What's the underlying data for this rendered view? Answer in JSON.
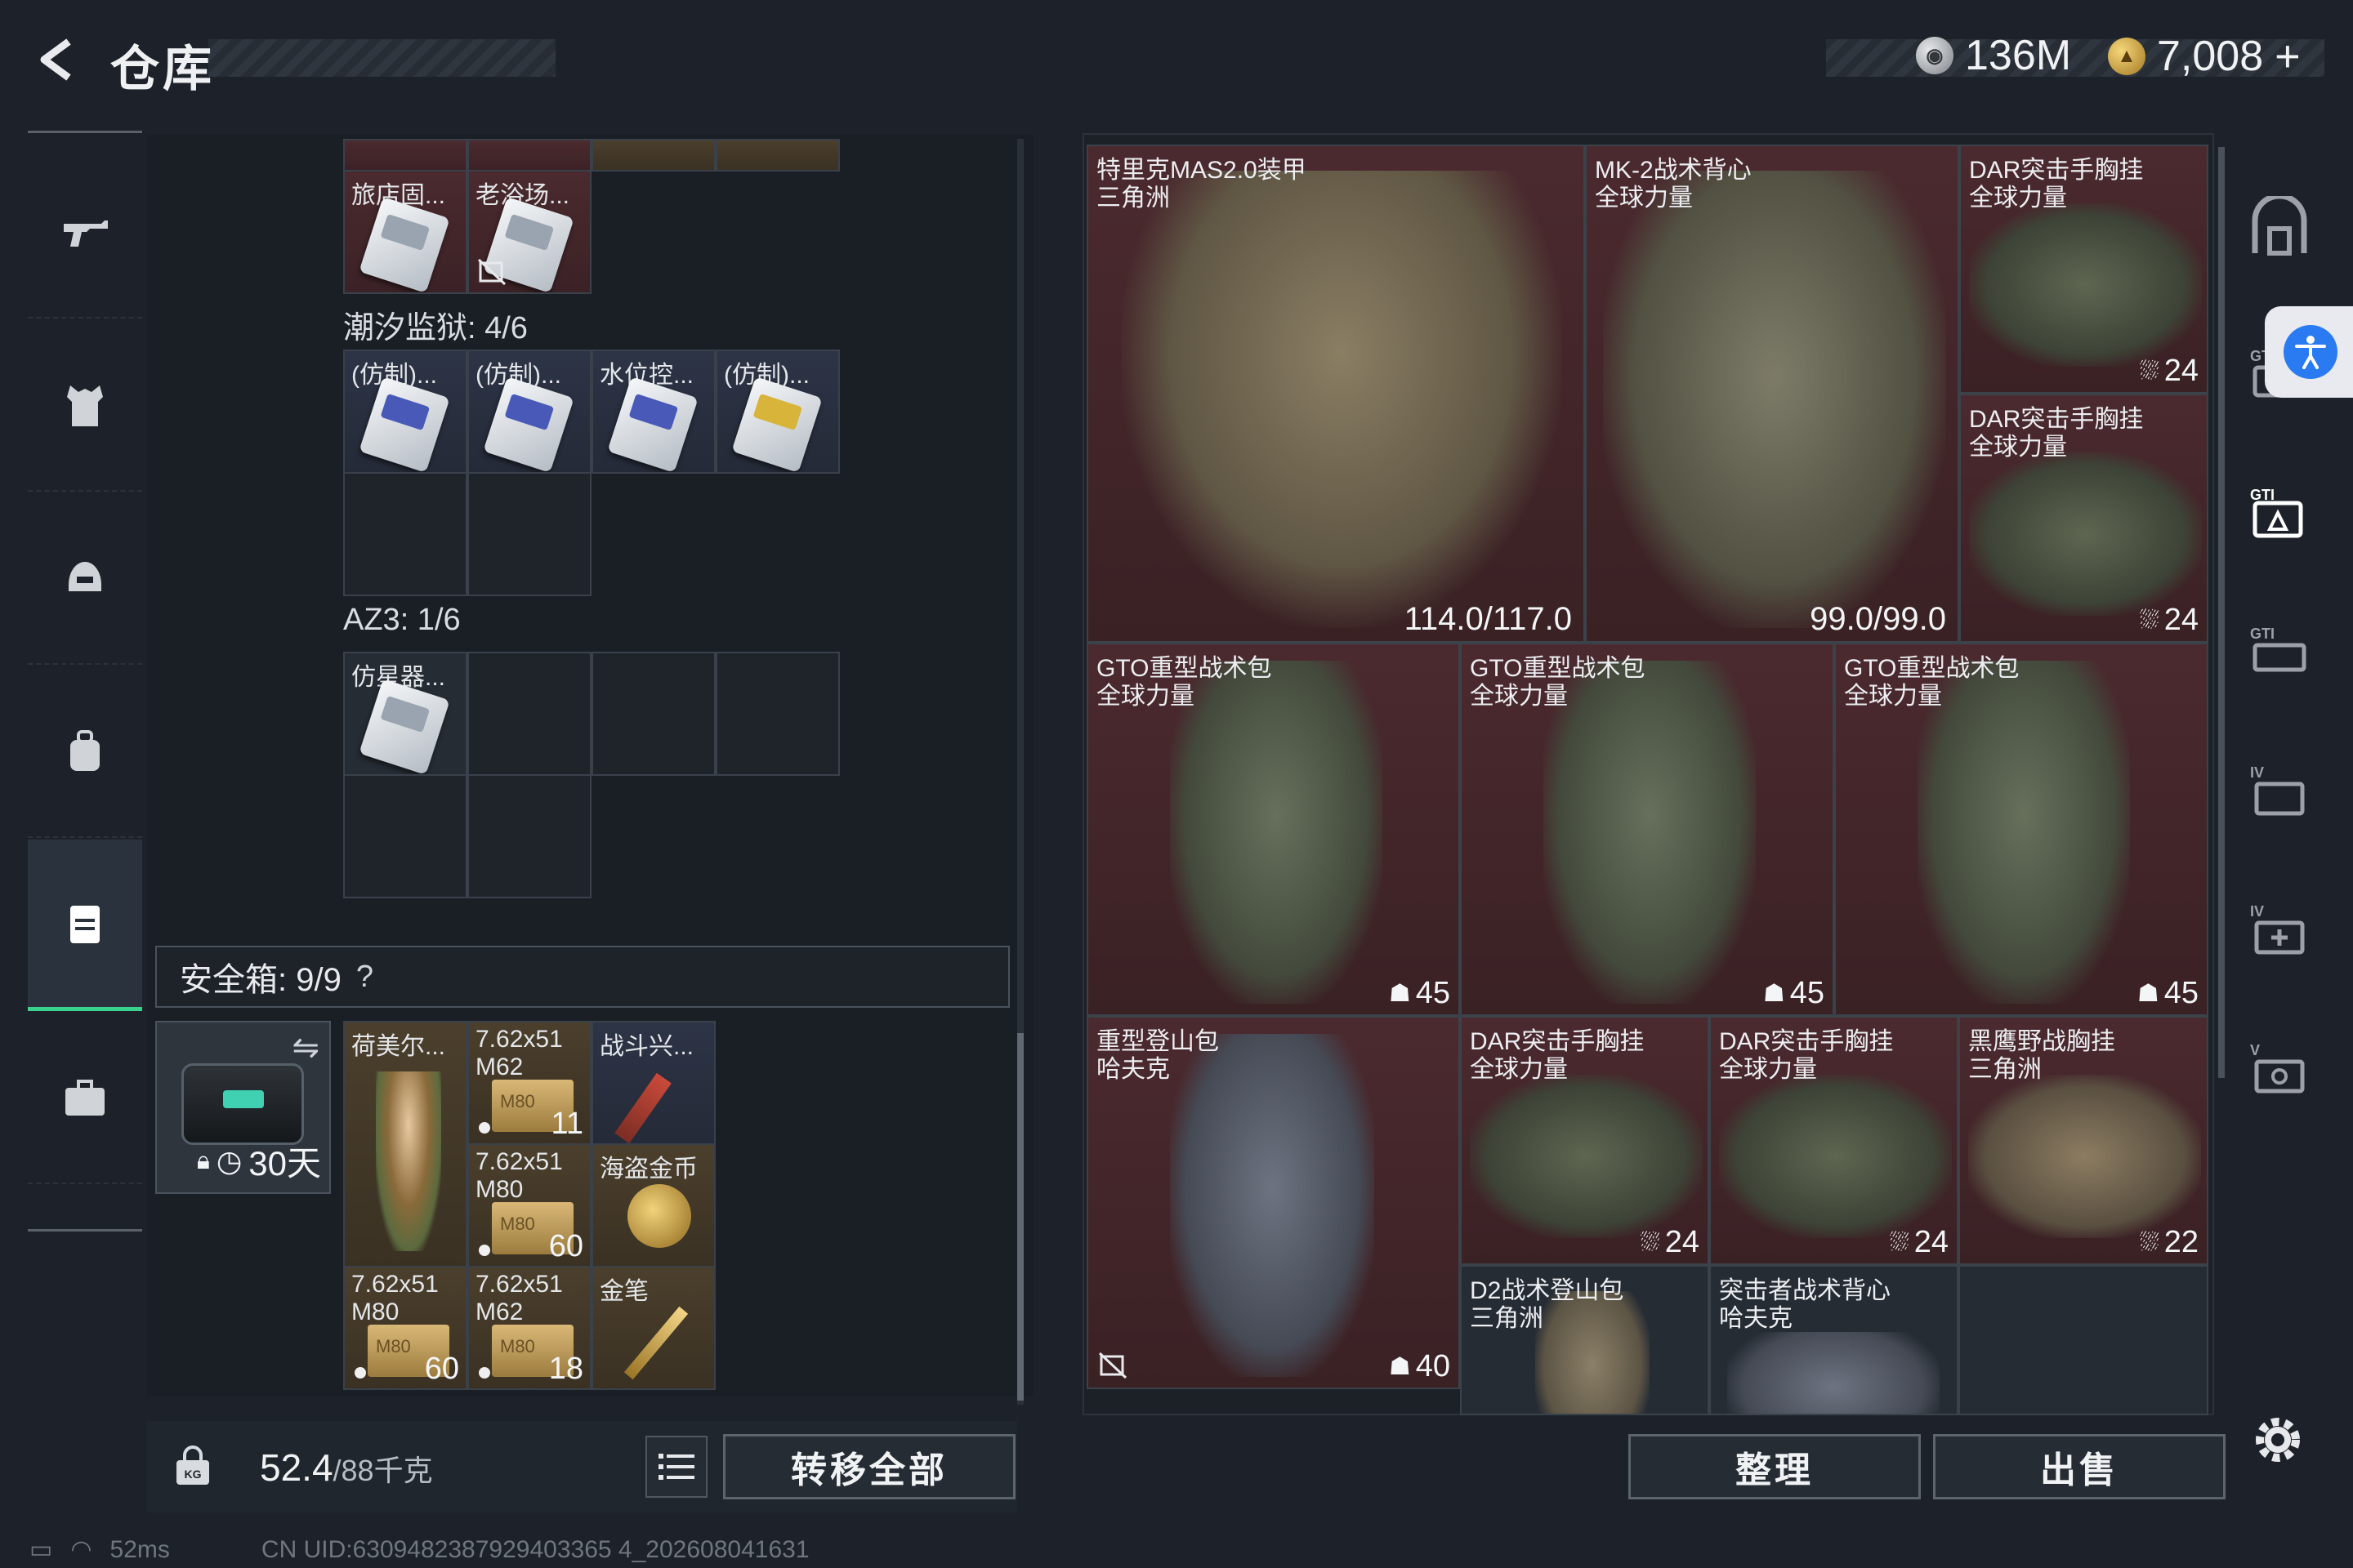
{
  "header": {
    "title": "仓库",
    "currencies": [
      {
        "icon": "silver-coin-icon",
        "value": "136M"
      },
      {
        "icon": "gold-coin-icon",
        "value": "7,008",
        "plus": "+"
      }
    ]
  },
  "rail": {
    "items": [
      {
        "name": "weapons",
        "icon": "pistol-icon"
      },
      {
        "name": "armor",
        "icon": "vest-icon"
      },
      {
        "name": "helmet",
        "icon": "helmet-icon"
      },
      {
        "name": "backpack",
        "icon": "backpack-icon"
      },
      {
        "name": "storage",
        "icon": "container-icon",
        "active": true
      },
      {
        "name": "misc",
        "icon": "briefcase-icon"
      }
    ]
  },
  "storage": {
    "top_partial": {
      "items": [
        {
          "label": "旅店固...",
          "kind": "card"
        },
        {
          "label": "老浴场...",
          "kind": "card",
          "no_sell": true
        }
      ]
    },
    "tide_prison": {
      "label": "潮汐监狱: 4/6",
      "items": [
        {
          "label": "(仿制)...",
          "kind": "card-blue"
        },
        {
          "label": "(仿制)...",
          "kind": "card-blue"
        },
        {
          "label": "水位控...",
          "kind": "card-blue"
        },
        {
          "label": "(仿制)...",
          "kind": "card-yellow"
        }
      ]
    },
    "az3": {
      "label": "AZ3: 1/6",
      "items": [
        {
          "label": "仿星器...",
          "kind": "card"
        }
      ]
    },
    "safe_box": {
      "label": "安全箱: 9/9",
      "help": "?",
      "duration": "30天",
      "items": [
        {
          "label": "荷美尔...",
          "count": ""
        },
        {
          "label": "7.62x51",
          "sub": "M62",
          "count": "11"
        },
        {
          "label": "战斗兴...",
          "count": ""
        },
        {
          "label": "7.62x51",
          "sub": "M80",
          "count": "60"
        },
        {
          "label": "海盗金币",
          "count": ""
        },
        {
          "label": "7.62x51",
          "sub": "M80",
          "count": "60"
        },
        {
          "label": "7.62x51",
          "sub": "M62",
          "count": "18"
        },
        {
          "label": "金笔",
          "count": ""
        }
      ]
    },
    "weight": {
      "value": "52.4",
      "max": "/88千克"
    },
    "transfer_all_label": "转移全部"
  },
  "loot": {
    "items": [
      {
        "name": "特里克MAS2.0装甲",
        "sub": "三角洲",
        "durability": "114.0/117.0"
      },
      {
        "name": "MK-2战术背心",
        "sub": "全球力量",
        "durability": "99.0/99.0"
      },
      {
        "name": "DAR突击手胸挂",
        "sub": "全球力量",
        "count": "24"
      },
      {
        "name": "DAR突击手胸挂",
        "sub": "全球力量",
        "count": "24"
      },
      {
        "name": "GTO重型战术包",
        "sub": "全球力量",
        "count": "45"
      },
      {
        "name": "GTO重型战术包",
        "sub": "全球力量",
        "count": "45"
      },
      {
        "name": "GTO重型战术包",
        "sub": "全球力量",
        "count": "45"
      },
      {
        "name": "重型登山包",
        "sub": "哈夫克",
        "count": "40"
      },
      {
        "name": "DAR突击手胸挂",
        "sub": "全球力量",
        "count": "24"
      },
      {
        "name": "DAR突击手胸挂",
        "sub": "全球力量",
        "count": "24"
      },
      {
        "name": "黑鹰野战胸挂",
        "sub": "三角洲",
        "count": "22"
      },
      {
        "name": "D2战术登山包",
        "sub": "三角洲",
        "count": ""
      },
      {
        "name": "突击者战术背心",
        "sub": "哈夫克",
        "count": ""
      }
    ],
    "organize_label": "整理",
    "sell_label": "出售"
  },
  "status": {
    "ping": "52ms",
    "uid": "CN UID:6309482387929403365 4_202608041631"
  },
  "colors": {
    "accent": "#39d38b",
    "loot_bg": "#4b2a2f",
    "panel_bg": "#1a1f26"
  }
}
